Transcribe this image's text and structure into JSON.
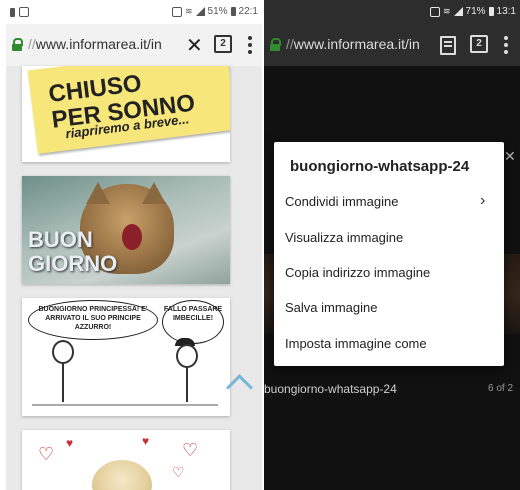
{
  "left_phone": {
    "status": {
      "battery": "51%",
      "time": "22:1"
    },
    "urlbar": {
      "url_prefix": "//",
      "url_host": "www.informarea.it/in",
      "tabs_count": "2"
    },
    "cards": {
      "sign": {
        "line1": "CHIUSO",
        "line2": "PER SONNO",
        "line3": "riapriremo a breve..."
      },
      "photo_text": {
        "line1": "BUON",
        "line2": "GIORNO"
      },
      "comic": {
        "bubble_left": "BUONGIORNO PRINCIPESSA! E' ARRIVATO IL SUO PRINCIPE AZZURRO!",
        "bubble_right": "FALLO PASSARE IMBECILLE!"
      }
    }
  },
  "right_phone": {
    "status": {
      "battery": "71%",
      "time": "13:1"
    },
    "urlbar": {
      "url_prefix": "//",
      "url_host": "www.informarea.it/in",
      "tabs_count": "2"
    },
    "context_menu": {
      "title": "buongiorno-whatsapp-24",
      "items": [
        "Condividi immagine",
        "Visualizza immagine",
        "Copia indirizzo immagine",
        "Salva immagine",
        "Imposta immagine come"
      ]
    },
    "caption": "buongiorno-whatsapp-24",
    "counter": "6 of 2"
  }
}
